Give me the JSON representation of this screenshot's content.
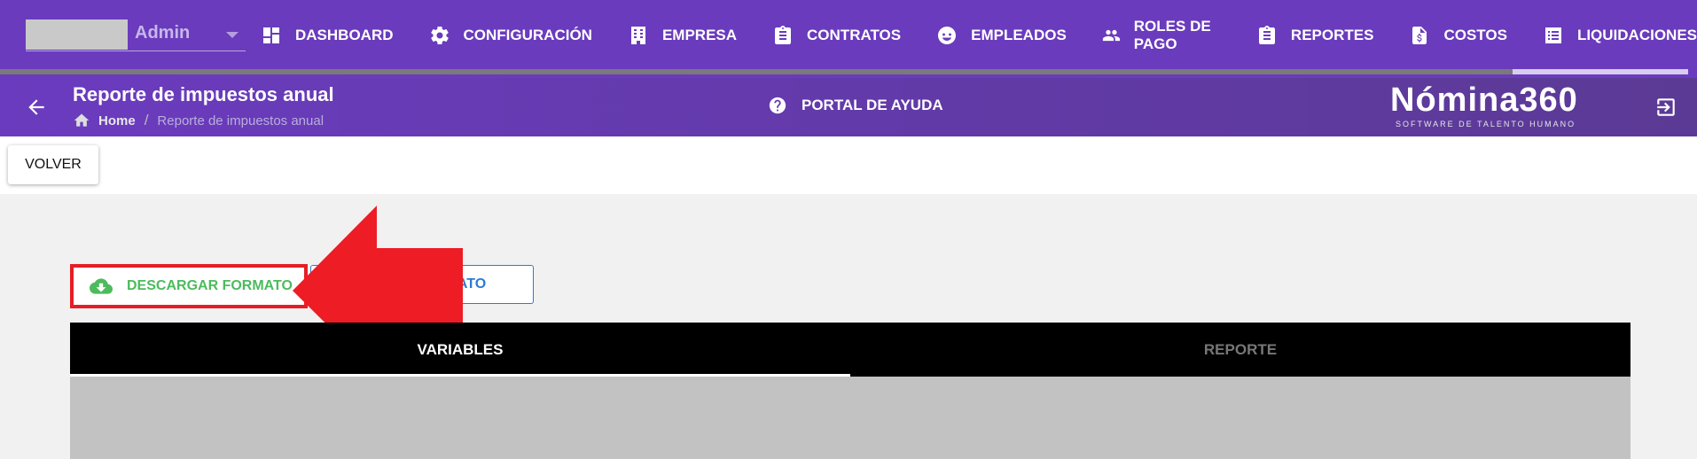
{
  "company": {
    "name": "Admin"
  },
  "nav": {
    "items": [
      {
        "label": "DASHBOARD",
        "icon": "dashboard-icon"
      },
      {
        "label": "CONFIGURACIÓN",
        "icon": "gear-icon"
      },
      {
        "label": "EMPRESA",
        "icon": "building-icon"
      },
      {
        "label": "CONTRATOS",
        "icon": "clipboard-icon"
      },
      {
        "label": "EMPLEADOS",
        "icon": "face-icon"
      },
      {
        "label": "ROLES DE PAGO",
        "icon": "people-icon"
      },
      {
        "label": "REPORTES",
        "icon": "clipboard-list-icon"
      },
      {
        "label": "COSTOS",
        "icon": "invoice-dollar-icon"
      },
      {
        "label": "LIQUIDACIONES",
        "icon": "list-icon"
      }
    ]
  },
  "header": {
    "title": "Reporte de impuestos anual",
    "breadcrumb": {
      "home": "Home",
      "separator": "/",
      "current": "Reporte de impuestos anual"
    },
    "help_label": "PORTAL DE AYUDA",
    "brand_name": "Nómina360",
    "brand_tagline": "SOFTWARE DE TALENTO HUMANO"
  },
  "toolbar": {
    "back_label": "VOLVER"
  },
  "actions": {
    "download_label": "DESCARGAR FORMATO",
    "upload_label_visible": "RMATO"
  },
  "tabs": [
    {
      "label": "VARIABLES",
      "active": true
    },
    {
      "label": "REPORTE",
      "active": false
    }
  ],
  "colors": {
    "nav_bg": "#6a3bbd",
    "download_green": "#4cbb5c",
    "highlight_red": "#e41e26",
    "upload_blue": "#2b7bd1"
  }
}
